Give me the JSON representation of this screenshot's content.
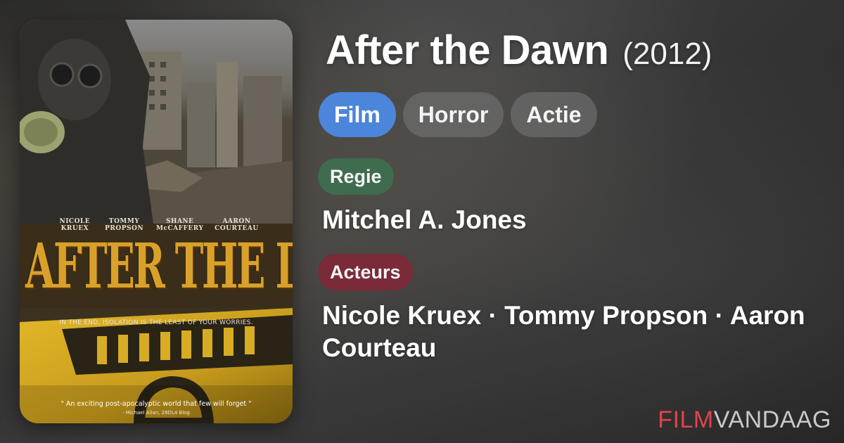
{
  "movie": {
    "title": "After the Dawn",
    "year": "(2012)"
  },
  "genres": [
    {
      "label": "Film",
      "color": "#4b86db"
    },
    {
      "label": "Horror"
    },
    {
      "label": "Actie"
    }
  ],
  "director": {
    "label": "Regie",
    "label_color": "#3f6b4f",
    "name": "Mitchel A. Jones"
  },
  "cast": {
    "label": "Acteurs",
    "label_color": "#7a2a38",
    "names": "Nicole Kruex · Tommy Propson · Aaron Courteau"
  },
  "poster": {
    "cast_names": [
      "NICOLE KRUEX",
      "TOMMY PROPSON",
      "SHANE McCAFFERY",
      "AARON COURTEAU"
    ],
    "title": "AFTER THE DAWN",
    "tagline": "IN THE END, ISOLATION IS THE LEAST OF YOUR WORRIES.",
    "quote": "\" An exciting post-apocalyptic world that few will forget \"",
    "quote_credit": "- Michael Allan, 28DL4 Blog"
  },
  "brand": {
    "part1": "FILM",
    "part2": "VANDAAG",
    "color1": "#e2434a",
    "color2": "#c9c9c9"
  }
}
